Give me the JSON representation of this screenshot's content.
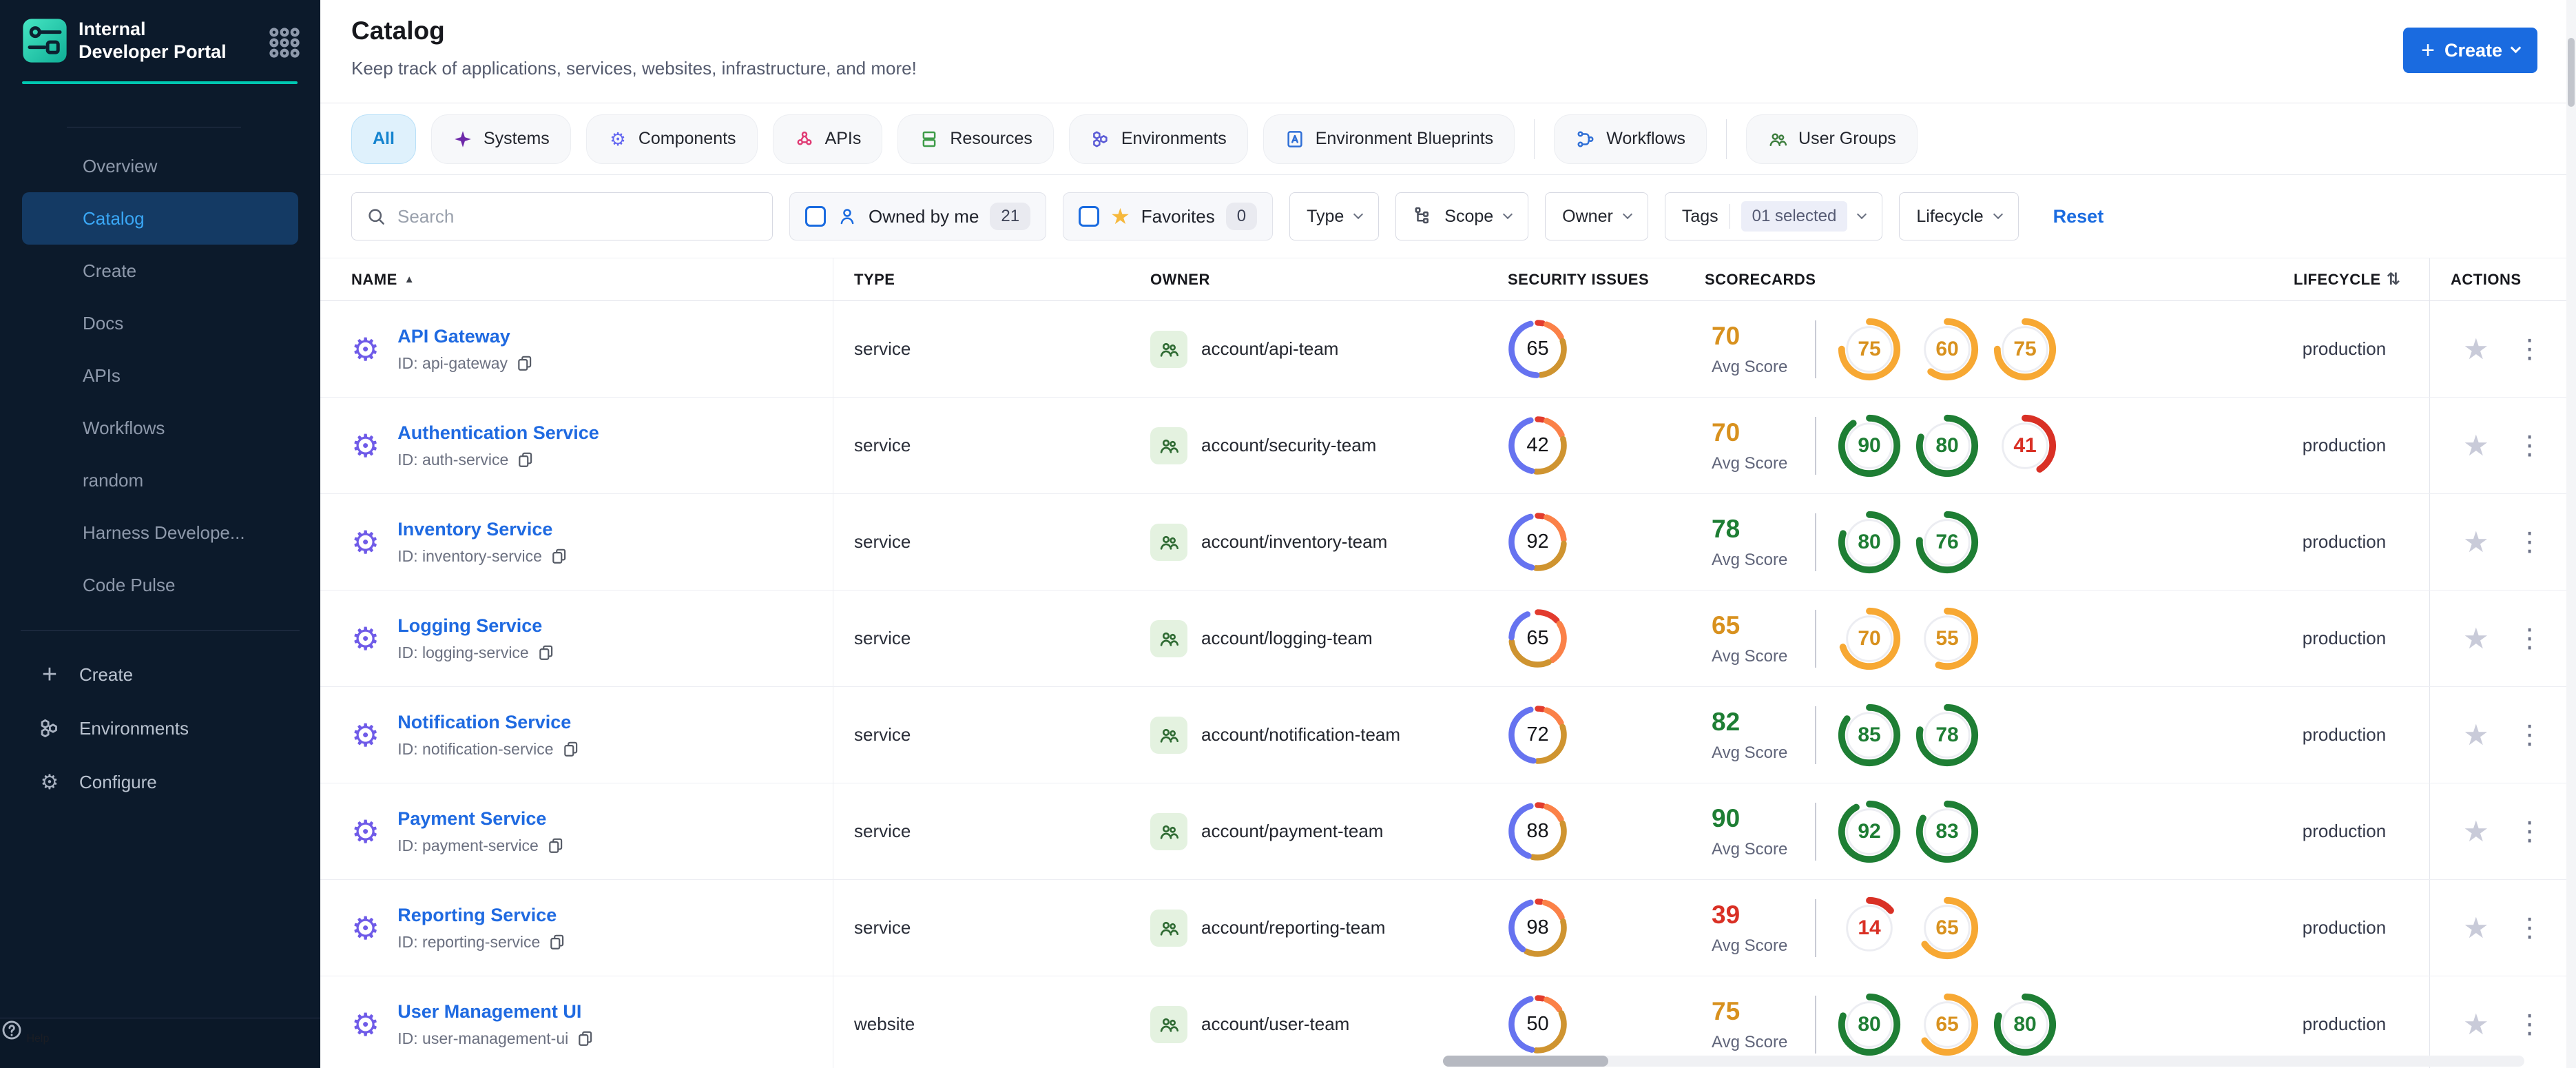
{
  "colors": {
    "accent_teal": "#00c7b1",
    "sidebar_bg": "#0c1a2b",
    "sidebar_active_bg": "#143a64",
    "sidebar_active_text": "#3aa7f5",
    "primary_blue": "#1a6be0",
    "link_blue": "#1f6ae1",
    "entity_purple": "#6f5be8",
    "donut": {
      "blue": "#6673f0",
      "gold": "#cf9430",
      "orange": "#fb8148",
      "red": "#e23b2e"
    },
    "score_green": "#1e7e34",
    "score_orange_ring": "#f7a833",
    "score_orange_text": "#d8911e",
    "score_red": "#d93025",
    "tab_active_bg": "#dff1fc",
    "tab_active_text": "#1584cf",
    "owner_chip_bg": "#e4f2e0",
    "owner_icon_green": "#2f6b33"
  },
  "sidebar": {
    "title": "Internal Developer Portal",
    "nav": [
      {
        "label": "Overview",
        "active": false
      },
      {
        "label": "Catalog",
        "active": true
      },
      {
        "label": "Create",
        "active": false
      },
      {
        "label": "Docs",
        "active": false
      },
      {
        "label": "APIs",
        "active": false
      },
      {
        "label": "Workflows",
        "active": false
      },
      {
        "label": "random",
        "active": false
      },
      {
        "label": "Harness Develope...",
        "active": false
      },
      {
        "label": "Code Pulse",
        "active": false
      }
    ],
    "bottom_nav": [
      {
        "label": "Create",
        "icon": "plus"
      },
      {
        "label": "Environments",
        "icon": "hexes"
      },
      {
        "label": "Configure",
        "icon": "gear"
      }
    ],
    "footer": {
      "label": "Help"
    }
  },
  "header": {
    "title": "Catalog",
    "subtitle": "Keep track of applications, services, websites, infrastructure, and more!",
    "create_button_label": "Create"
  },
  "tab_groups": [
    {
      "tabs": [
        {
          "label": "All",
          "active": true,
          "icon": "",
          "color": ""
        },
        {
          "label": "Systems",
          "active": false,
          "icon": "star4",
          "color": "#6d28a9"
        },
        {
          "label": "Components",
          "active": false,
          "icon": "gear-outline",
          "color": "#6366f1"
        },
        {
          "label": "APIs",
          "active": false,
          "icon": "api",
          "color": "#e03b74"
        },
        {
          "label": "Resources",
          "active": false,
          "icon": "stack",
          "color": "#3f9c49"
        },
        {
          "label": "Environments",
          "active": false,
          "icon": "hexes",
          "color": "#5b5bd6"
        },
        {
          "label": "Environment Blueprints",
          "active": false,
          "icon": "blueprint",
          "color": "#2f6fd6"
        }
      ]
    },
    {
      "tabs": [
        {
          "label": "Workflows",
          "active": false,
          "icon": "workflow",
          "color": "#2f6fd6"
        }
      ]
    },
    {
      "tabs": [
        {
          "label": "User Groups",
          "active": false,
          "icon": "people",
          "color": "#3c7d3c"
        }
      ]
    }
  ],
  "filters": {
    "search_placeholder": "Search",
    "owned_by_me": {
      "label": "Owned by me",
      "count": "21"
    },
    "favorites": {
      "label": "Favorites",
      "count": "0"
    },
    "dropdowns": [
      {
        "label": "Type",
        "icon": "",
        "badge": ""
      },
      {
        "label": "Scope",
        "icon": "scope",
        "badge": ""
      },
      {
        "label": "Owner",
        "icon": "",
        "badge": ""
      },
      {
        "label": "Tags",
        "icon": "",
        "badge": "01 selected"
      },
      {
        "label": "Lifecycle",
        "icon": "",
        "badge": ""
      }
    ],
    "reset_label": "Reset"
  },
  "table": {
    "columns": [
      {
        "label": "NAME",
        "sort": "asc"
      },
      {
        "label": "TYPE"
      },
      {
        "label": "OWNER"
      },
      {
        "label": "SECURITY ISSUES"
      },
      {
        "label": "SCORECARDS"
      },
      {
        "label": "LIFECYCLE",
        "sort": "both"
      },
      {
        "label": "ACTIONS"
      }
    ],
    "avg_score_label": "Avg Score",
    "rows": [
      {
        "name": "API Gateway",
        "id_label": "ID: api-gateway",
        "type": "service",
        "owner": "account/api-team",
        "security_issues": 65,
        "security_segments": [
          [
            "red",
            3
          ],
          [
            "orange",
            12
          ],
          [
            "gold",
            28
          ],
          [
            "blue",
            45
          ]
        ],
        "avg_score": 70,
        "scorecards": [
          75,
          60,
          75
        ],
        "lifecycle": "production"
      },
      {
        "name": "Authentication Service",
        "id_label": "ID: auth-service",
        "type": "service",
        "owner": "account/security-team",
        "security_issues": 42,
        "security_segments": [
          [
            "red",
            3
          ],
          [
            "orange",
            13
          ],
          [
            "gold",
            30
          ],
          [
            "blue",
            42
          ]
        ],
        "avg_score": 70,
        "scorecards": [
          90,
          80,
          41
        ],
        "lifecycle": "production"
      },
      {
        "name": "Inventory Service",
        "id_label": "ID: inventory-service",
        "type": "service",
        "owner": "account/inventory-team",
        "security_issues": 92,
        "security_segments": [
          [
            "red",
            3
          ],
          [
            "orange",
            18
          ],
          [
            "gold",
            25
          ],
          [
            "blue",
            42
          ]
        ],
        "avg_score": 78,
        "scorecards": [
          80,
          76
        ],
        "lifecycle": "production"
      },
      {
        "name": "Logging Service",
        "id_label": "ID: logging-service",
        "type": "service",
        "owner": "account/logging-team",
        "security_issues": 65,
        "security_segments": [
          [
            "red",
            13
          ],
          [
            "orange",
            25
          ],
          [
            "gold",
            30
          ],
          [
            "blue",
            18
          ]
        ],
        "avg_score": 65,
        "scorecards": [
          70,
          55
        ],
        "lifecycle": "production"
      },
      {
        "name": "Notification Service",
        "id_label": "ID: notification-service",
        "type": "service",
        "owner": "account/notification-team",
        "security_issues": 72,
        "security_segments": [
          [
            "red",
            3
          ],
          [
            "orange",
            12
          ],
          [
            "gold",
            30
          ],
          [
            "blue",
            43
          ]
        ],
        "avg_score": 82,
        "scorecards": [
          85,
          78
        ],
        "lifecycle": "production"
      },
      {
        "name": "Payment Service",
        "id_label": "ID: payment-service",
        "type": "service",
        "owner": "account/payment-team",
        "security_issues": 88,
        "security_segments": [
          [
            "red",
            3
          ],
          [
            "orange",
            12
          ],
          [
            "gold",
            33
          ],
          [
            "blue",
            40
          ]
        ],
        "avg_score": 90,
        "scorecards": [
          92,
          83
        ],
        "lifecycle": "production"
      },
      {
        "name": "Reporting Service",
        "id_label": "ID: reporting-service",
        "type": "service",
        "owner": "account/reporting-team",
        "security_issues": 98,
        "security_segments": [
          [
            "red",
            2
          ],
          [
            "orange",
            14
          ],
          [
            "gold",
            36
          ],
          [
            "blue",
            36
          ]
        ],
        "avg_score": 39,
        "scorecards": [
          14,
          65
        ],
        "lifecycle": "production"
      },
      {
        "name": "User Management UI",
        "id_label": "ID: user-management-ui",
        "type": "website",
        "owner": "account/user-team",
        "security_issues": 50,
        "security_segments": [
          [
            "red",
            3
          ],
          [
            "orange",
            10
          ],
          [
            "gold",
            33
          ],
          [
            "blue",
            42
          ]
        ],
        "avg_score": 75,
        "scorecards": [
          80,
          65,
          80
        ],
        "lifecycle": "production"
      }
    ]
  }
}
